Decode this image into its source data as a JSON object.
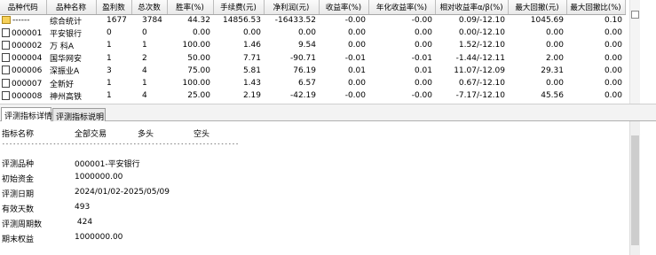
{
  "grid": {
    "columns": [
      "品种代码",
      "品种名称",
      "盈利数",
      "总次数",
      "胜率(%)",
      "手续费(元)",
      "净利润(元)",
      "收益率(%)",
      "年化收益率(%)",
      "相对收益率α/β(%)",
      "最大回撤(元)",
      "最大回撤比(%)"
    ],
    "rows": [
      {
        "icon": "folder-icon",
        "cells": [
          "------",
          "综合统计",
          "1677",
          "3784",
          "44.32",
          "14856.53",
          "-16433.52",
          "-0.00",
          "-0.00",
          "0.09/-12.10",
          "1045.69",
          "0.10"
        ]
      },
      {
        "icon": "document-icon",
        "cells": [
          "000001",
          "平安银行",
          "0",
          "0",
          "0.00",
          "0.00",
          "0.00",
          "0.00",
          "0.00",
          "0.00/-12.10",
          "0.00",
          "0.00"
        ]
      },
      {
        "icon": "document-icon",
        "cells": [
          "000002",
          "万 科A",
          "1",
          "1",
          "100.00",
          "1.46",
          "9.54",
          "0.00",
          "0.00",
          "1.52/-12.10",
          "0.00",
          "0.00"
        ]
      },
      {
        "icon": "document-icon",
        "cells": [
          "000004",
          "国华网安",
          "1",
          "2",
          "50.00",
          "7.71",
          "-90.71",
          "-0.01",
          "-0.01",
          "-1.44/-12.11",
          "2.00",
          "0.00"
        ]
      },
      {
        "icon": "document-icon",
        "cells": [
          "000006",
          "深振业A",
          "3",
          "4",
          "75.00",
          "5.81",
          "76.19",
          "0.01",
          "0.01",
          "11.07/-12.09",
          "29.31",
          "0.00"
        ]
      },
      {
        "icon": "document-icon",
        "cells": [
          "000007",
          "全新好",
          "1",
          "1",
          "100.00",
          "1.43",
          "6.57",
          "0.00",
          "0.00",
          "0.67/-12.10",
          "0.00",
          "0.00"
        ]
      },
      {
        "icon": "document-icon",
        "cells": [
          "000008",
          "神州高铁",
          "1",
          "4",
          "25.00",
          "2.19",
          "-42.19",
          "-0.00",
          "-0.00",
          "-7.17/-12.10",
          "45.56",
          "0.00"
        ]
      }
    ]
  },
  "tabs": [
    {
      "label": "评测指标详情",
      "active": true
    },
    {
      "label": "评测指标说明",
      "active": false
    }
  ],
  "detail": {
    "headers": {
      "name": "指标名称",
      "all": "全部交易",
      "long": "多头",
      "short": "空头"
    },
    "separator": "--------------------------------------------------------------------------------------",
    "rows": [
      {
        "label": "评测品种",
        "value": "000001-平安银行"
      },
      {
        "label": "初始资金",
        "value": "1000000.00"
      },
      {
        "label": "评测日期",
        "value": "2024/01/02-2025/05/09"
      },
      {
        "label": "有效天数",
        "value": "493"
      },
      {
        "label": "评测周期数",
        "value": " 424"
      },
      {
        "label": "期末权益",
        "value": "1000000.00"
      }
    ]
  }
}
